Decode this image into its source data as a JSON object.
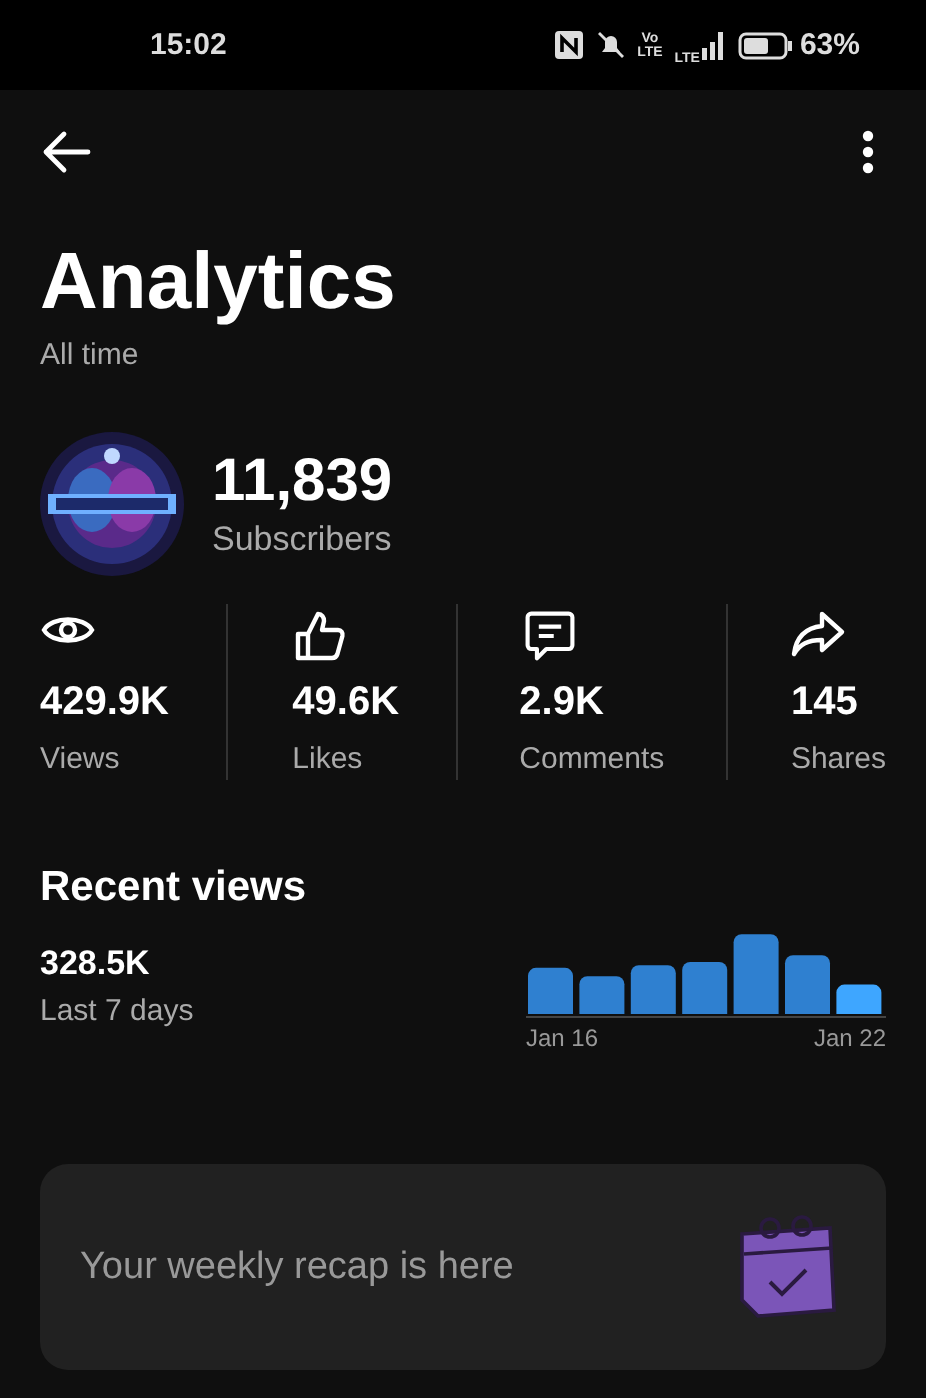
{
  "status_bar": {
    "time": "15:02",
    "volte_top": "Vo",
    "volte_bottom": "LTE",
    "signal_label": "LTE",
    "battery": "63%"
  },
  "header": {
    "title": "Analytics",
    "subtitle": "All time"
  },
  "channel": {
    "subscribers": "11,839",
    "subscribers_label": "Subscribers"
  },
  "stats": [
    {
      "kind": "views",
      "value": "429.9K",
      "label": "Views"
    },
    {
      "kind": "likes",
      "value": "49.6K",
      "label": "Likes"
    },
    {
      "kind": "comments",
      "value": "2.9K",
      "label": "Comments"
    },
    {
      "kind": "shares",
      "value": "145",
      "label": "Shares"
    }
  ],
  "recent_views": {
    "title": "Recent views",
    "value": "328.5K",
    "period": "Last 7 days",
    "chart_start_label": "Jan 16",
    "chart_end_label": "Jan 22"
  },
  "recap": {
    "text": "Your weekly recap is here"
  }
}
